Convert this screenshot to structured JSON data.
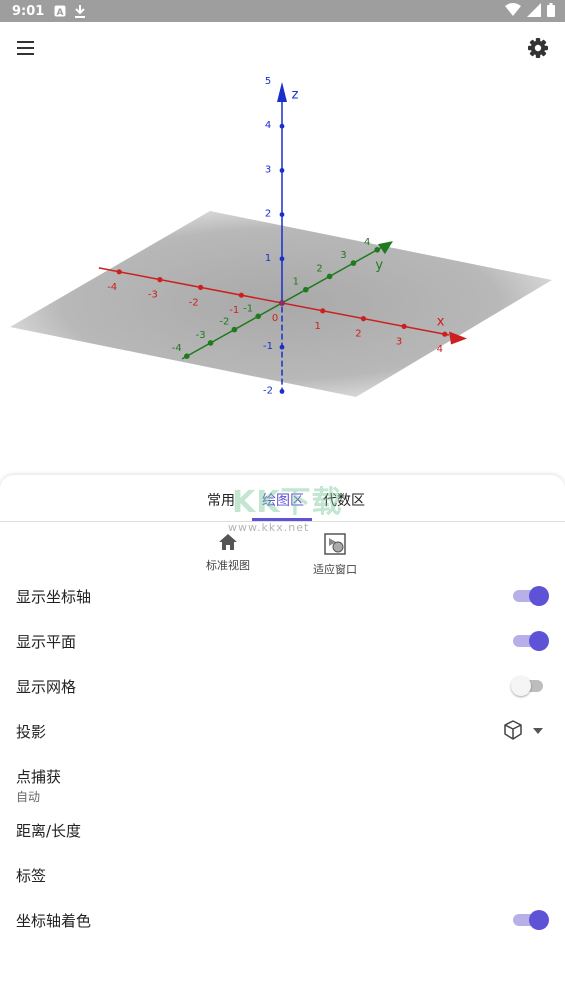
{
  "status": {
    "time": "9:01"
  },
  "tabs": [
    {
      "label": "常用"
    },
    {
      "label": "绘图区"
    },
    {
      "label": "代数区"
    }
  ],
  "watermark": {
    "big": "KK下载",
    "small": "www.kkx.net"
  },
  "tools": {
    "standard_view": "标准视图",
    "fit_window": "适应窗口"
  },
  "settings": {
    "show_axes": {
      "label": "显示坐标轴",
      "value": true
    },
    "show_plane": {
      "label": "显示平面",
      "value": true
    },
    "show_grid": {
      "label": "显示网格",
      "value": false
    },
    "projection": {
      "label": "投影",
      "icon": "cube-icon"
    },
    "point_capture": {
      "label": "点捕获",
      "value": "自动"
    },
    "distance": {
      "label": "距离/长度"
    },
    "labels": {
      "label": "标签"
    },
    "axis_coloring": {
      "label": "坐标轴着色",
      "value": true
    }
  },
  "graph": {
    "axis_names": {
      "x": "x",
      "y": "y",
      "z": "z"
    },
    "x_ticks": [
      "-4",
      "-3",
      "-2",
      "-1",
      "0",
      "1",
      "2",
      "3",
      "4"
    ],
    "y_ticks": [
      "-4",
      "-3",
      "-2",
      "-1",
      "0",
      "1",
      "2",
      "3",
      "4"
    ],
    "z_ticks": [
      "-2",
      "-1",
      "0",
      "1",
      "2",
      "3",
      "4",
      "5"
    ],
    "colors": {
      "x": "#cc1f1f",
      "y": "#1f7a1f",
      "z": "#1a2ecc",
      "accent": "#5e52d6"
    }
  }
}
